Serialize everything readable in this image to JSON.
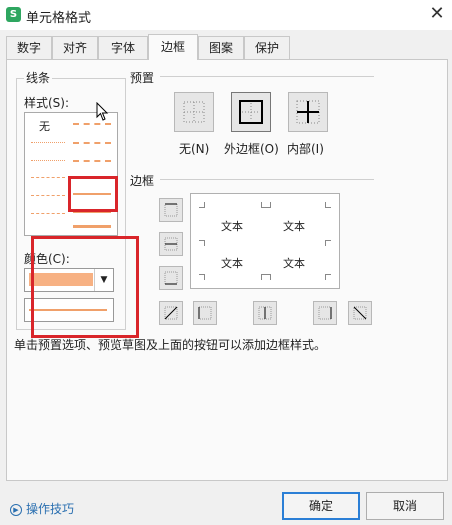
{
  "window": {
    "title": "单元格格式",
    "app_icon": "S"
  },
  "tabs": [
    {
      "label": "数字"
    },
    {
      "label": "对齐"
    },
    {
      "label": "字体"
    },
    {
      "label": "边框"
    },
    {
      "label": "图案"
    },
    {
      "label": "保护"
    }
  ],
  "active_tab": "边框",
  "line_group": {
    "title": "线条",
    "style_label": "样式(S):",
    "none_label": "无",
    "color_label": "颜色(C):",
    "selected_color": "#f7b183"
  },
  "presets": {
    "title": "预置",
    "none": "无(N)",
    "outline": "外边框(O)",
    "inside": "内部(I)"
  },
  "border": {
    "title": "边框",
    "preview_texts": [
      "文本",
      "文本",
      "文本",
      "文本"
    ]
  },
  "hint": "单击预置选项、预览草图及上面的按钮可以添加边框样式。",
  "footer": {
    "help": "操作技巧",
    "ok": "确定",
    "cancel": "取消"
  },
  "accent_color": "#f7b183",
  "highlight_color": "#d9252a"
}
